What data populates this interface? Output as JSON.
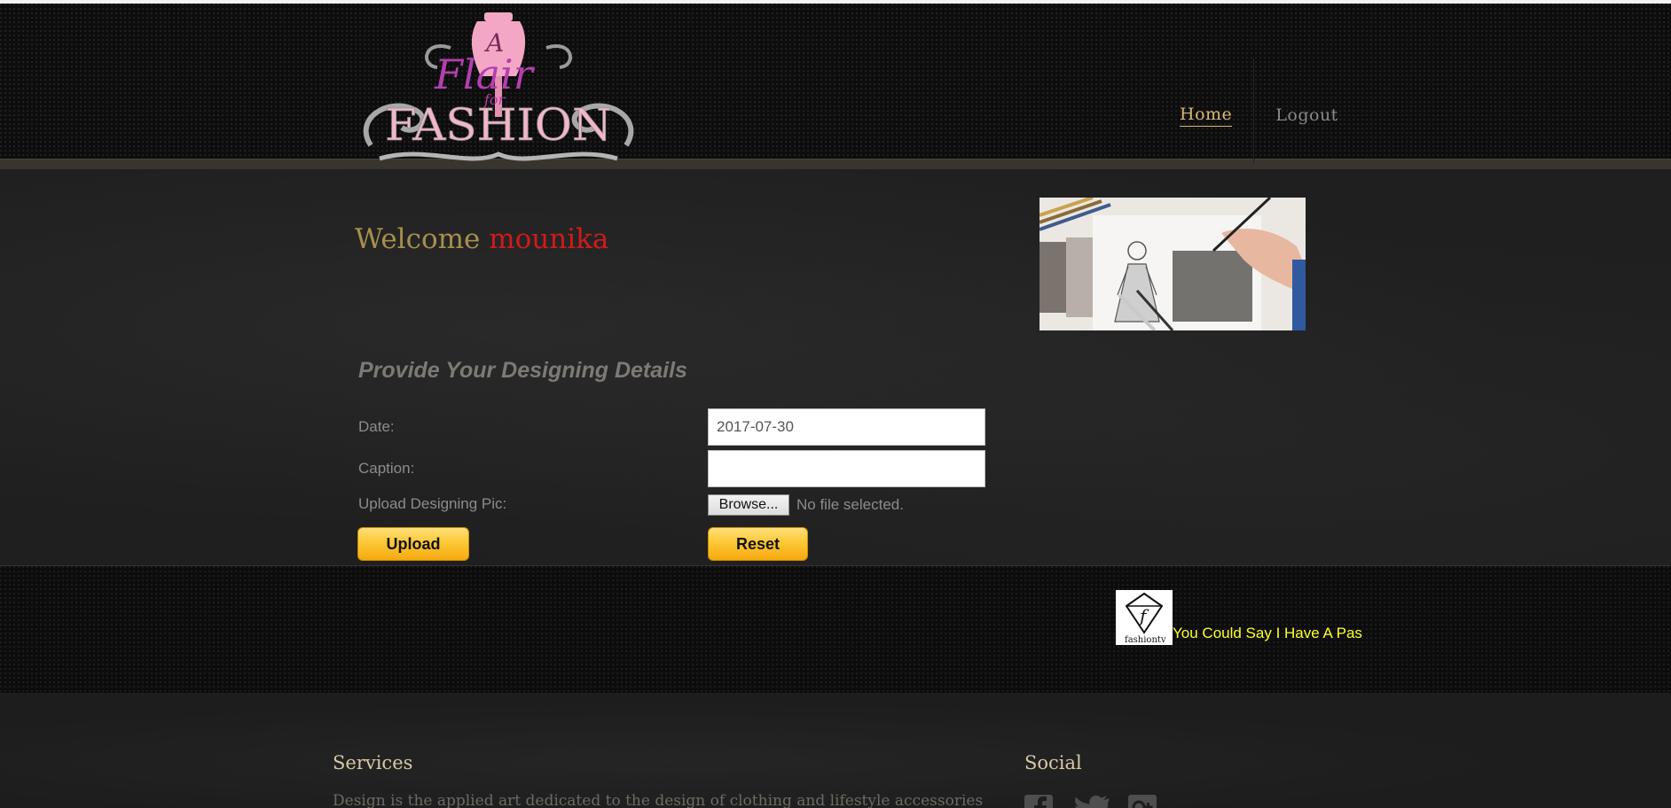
{
  "header": {
    "logo": {
      "line1": "A",
      "line2": "Flair",
      "line3": "for",
      "line4": "FASHION"
    },
    "nav": {
      "home": "Home",
      "logout": "Logout"
    }
  },
  "welcome": {
    "greeting": "Welcome",
    "username": "mounika"
  },
  "form": {
    "title": "Provide Your Designing Details",
    "date_label": "Date:",
    "date_value": "2017-07-30",
    "caption_label": "Caption:",
    "caption_value": "",
    "upload_label": "Upload Designing Pic:",
    "browse_label": "Browse...",
    "no_file_text": "No file selected.",
    "upload_button": "Upload",
    "reset_button": "Reset"
  },
  "ticker": {
    "brand_letter": "f",
    "brand_name": "fashiontv",
    "text": "You Could Say I Have A Pas"
  },
  "footer": {
    "services_heading": "Services",
    "services_text": "Design is the applied art dedicated to the design of clothing and lifestyle accessories",
    "social_heading": "Social",
    "social_icons": [
      "facebook-icon",
      "twitter-icon",
      "google-plus-icon"
    ]
  },
  "colors": {
    "accent_gold": "#d9b87a",
    "username_red": "#d11a1a",
    "ticker_yellow": "#ffff2a",
    "button_yellow": "#fcc836"
  }
}
